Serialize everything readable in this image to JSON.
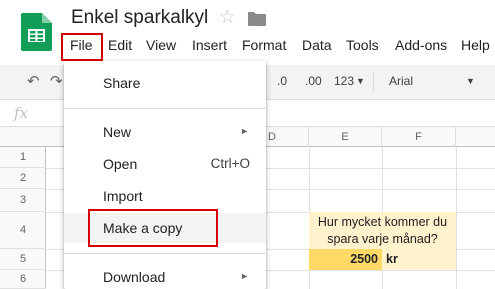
{
  "app": {
    "title": "Enkel sparkalkyl",
    "logo_icon": "google-sheets-icon",
    "star_icon": "star-icon",
    "folder_icon": "folder-icon",
    "brand_color": "#0f9d58",
    "highlight_color": "#d50000"
  },
  "menubar": {
    "items": [
      "File",
      "Edit",
      "View",
      "Insert",
      "Format",
      "Data",
      "Tools",
      "Add-ons",
      "Help"
    ]
  },
  "toolbar": {
    "decimal_decrease": ".0",
    "decimal_increase": ".00",
    "number_format": "123",
    "font": "Arial"
  },
  "formula_bar": {
    "fx_label": "fx"
  },
  "grid": {
    "columns": [
      "D",
      "E",
      "F"
    ],
    "rows": [
      "1",
      "2",
      "3",
      "4",
      "5",
      "6"
    ],
    "cells": {
      "question": [
        "Hur mycket kommer du",
        "spara varje månad?"
      ],
      "amount": "2500",
      "unit": "kr"
    },
    "colors": {
      "question_bg": "#fff2cc",
      "amount_bg": "#ffd966"
    }
  },
  "file_menu": {
    "items": [
      {
        "label": "Share",
        "shortcut": "",
        "submenu": false
      },
      {
        "label": "New",
        "shortcut": "",
        "submenu": true
      },
      {
        "label": "Open",
        "shortcut": "Ctrl+O",
        "submenu": false
      },
      {
        "label": "Import",
        "shortcut": "",
        "submenu": false
      },
      {
        "label": "Make a copy",
        "shortcut": "",
        "submenu": false,
        "highlighted": true
      },
      {
        "label": "Download",
        "shortcut": "",
        "submenu": true
      }
    ]
  }
}
